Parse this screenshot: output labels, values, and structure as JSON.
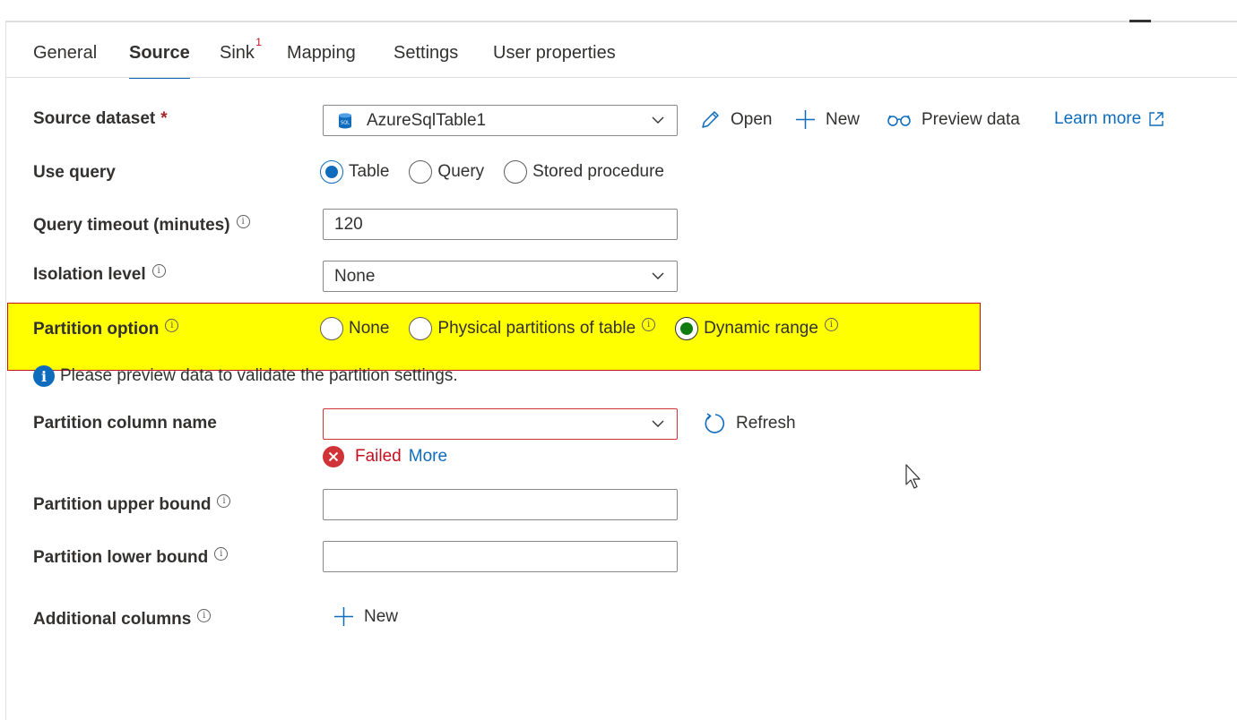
{
  "tabs": [
    {
      "label": "General",
      "active": false
    },
    {
      "label": "Source",
      "active": true
    },
    {
      "label": "Sink",
      "active": false,
      "badge": "1"
    },
    {
      "label": "Mapping",
      "active": false
    },
    {
      "label": "Settings",
      "active": false
    },
    {
      "label": "User properties",
      "active": false
    }
  ],
  "source_dataset": {
    "label": "Source dataset",
    "required_mark": "*",
    "value": "AzureSqlTable1",
    "open_label": "Open",
    "new_label": "New",
    "preview_label": "Preview data",
    "learn_more_label": "Learn more"
  },
  "use_query": {
    "label": "Use query",
    "options": [
      "Table",
      "Query",
      "Stored procedure"
    ],
    "selected": "Table"
  },
  "query_timeout": {
    "label": "Query timeout (minutes)",
    "value": "120"
  },
  "isolation_level": {
    "label": "Isolation level",
    "value": "None"
  },
  "partition_option": {
    "label": "Partition option",
    "options": [
      "None",
      "Physical partitions of table",
      "Dynamic range"
    ],
    "selected": "Dynamic range"
  },
  "info_message": "Please preview data to validate the partition settings.",
  "partition_column": {
    "label": "Partition column name",
    "value": "",
    "refresh_label": "Refresh",
    "error_text": "Failed",
    "more_label": "More"
  },
  "upper_bound": {
    "label": "Partition upper bound",
    "value": ""
  },
  "lower_bound": {
    "label": "Partition lower bound",
    "value": ""
  },
  "additional_columns": {
    "label": "Additional columns",
    "new_label": "New"
  },
  "colors": {
    "accent": "#0f6cbd",
    "error": "#d13438",
    "highlight": "#ffff00",
    "success": "#107c10"
  }
}
